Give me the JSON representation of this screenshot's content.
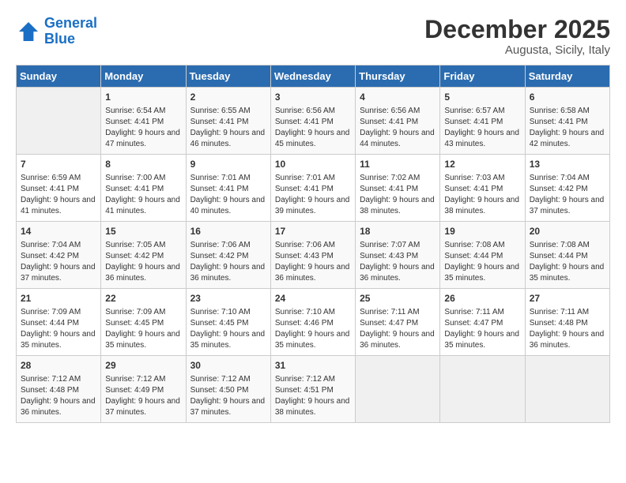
{
  "header": {
    "logo_line1": "General",
    "logo_line2": "Blue",
    "month_title": "December 2025",
    "location": "Augusta, Sicily, Italy"
  },
  "weekdays": [
    "Sunday",
    "Monday",
    "Tuesday",
    "Wednesday",
    "Thursday",
    "Friday",
    "Saturday"
  ],
  "weeks": [
    [
      {
        "day": "",
        "sunrise": "",
        "sunset": "",
        "daylight": ""
      },
      {
        "day": "1",
        "sunrise": "Sunrise: 6:54 AM",
        "sunset": "Sunset: 4:41 PM",
        "daylight": "Daylight: 9 hours and 47 minutes."
      },
      {
        "day": "2",
        "sunrise": "Sunrise: 6:55 AM",
        "sunset": "Sunset: 4:41 PM",
        "daylight": "Daylight: 9 hours and 46 minutes."
      },
      {
        "day": "3",
        "sunrise": "Sunrise: 6:56 AM",
        "sunset": "Sunset: 4:41 PM",
        "daylight": "Daylight: 9 hours and 45 minutes."
      },
      {
        "day": "4",
        "sunrise": "Sunrise: 6:56 AM",
        "sunset": "Sunset: 4:41 PM",
        "daylight": "Daylight: 9 hours and 44 minutes."
      },
      {
        "day": "5",
        "sunrise": "Sunrise: 6:57 AM",
        "sunset": "Sunset: 4:41 PM",
        "daylight": "Daylight: 9 hours and 43 minutes."
      },
      {
        "day": "6",
        "sunrise": "Sunrise: 6:58 AM",
        "sunset": "Sunset: 4:41 PM",
        "daylight": "Daylight: 9 hours and 42 minutes."
      }
    ],
    [
      {
        "day": "7",
        "sunrise": "Sunrise: 6:59 AM",
        "sunset": "Sunset: 4:41 PM",
        "daylight": "Daylight: 9 hours and 41 minutes."
      },
      {
        "day": "8",
        "sunrise": "Sunrise: 7:00 AM",
        "sunset": "Sunset: 4:41 PM",
        "daylight": "Daylight: 9 hours and 41 minutes."
      },
      {
        "day": "9",
        "sunrise": "Sunrise: 7:01 AM",
        "sunset": "Sunset: 4:41 PM",
        "daylight": "Daylight: 9 hours and 40 minutes."
      },
      {
        "day": "10",
        "sunrise": "Sunrise: 7:01 AM",
        "sunset": "Sunset: 4:41 PM",
        "daylight": "Daylight: 9 hours and 39 minutes."
      },
      {
        "day": "11",
        "sunrise": "Sunrise: 7:02 AM",
        "sunset": "Sunset: 4:41 PM",
        "daylight": "Daylight: 9 hours and 38 minutes."
      },
      {
        "day": "12",
        "sunrise": "Sunrise: 7:03 AM",
        "sunset": "Sunset: 4:41 PM",
        "daylight": "Daylight: 9 hours and 38 minutes."
      },
      {
        "day": "13",
        "sunrise": "Sunrise: 7:04 AM",
        "sunset": "Sunset: 4:42 PM",
        "daylight": "Daylight: 9 hours and 37 minutes."
      }
    ],
    [
      {
        "day": "14",
        "sunrise": "Sunrise: 7:04 AM",
        "sunset": "Sunset: 4:42 PM",
        "daylight": "Daylight: 9 hours and 37 minutes."
      },
      {
        "day": "15",
        "sunrise": "Sunrise: 7:05 AM",
        "sunset": "Sunset: 4:42 PM",
        "daylight": "Daylight: 9 hours and 36 minutes."
      },
      {
        "day": "16",
        "sunrise": "Sunrise: 7:06 AM",
        "sunset": "Sunset: 4:42 PM",
        "daylight": "Daylight: 9 hours and 36 minutes."
      },
      {
        "day": "17",
        "sunrise": "Sunrise: 7:06 AM",
        "sunset": "Sunset: 4:43 PM",
        "daylight": "Daylight: 9 hours and 36 minutes."
      },
      {
        "day": "18",
        "sunrise": "Sunrise: 7:07 AM",
        "sunset": "Sunset: 4:43 PM",
        "daylight": "Daylight: 9 hours and 36 minutes."
      },
      {
        "day": "19",
        "sunrise": "Sunrise: 7:08 AM",
        "sunset": "Sunset: 4:44 PM",
        "daylight": "Daylight: 9 hours and 35 minutes."
      },
      {
        "day": "20",
        "sunrise": "Sunrise: 7:08 AM",
        "sunset": "Sunset: 4:44 PM",
        "daylight": "Daylight: 9 hours and 35 minutes."
      }
    ],
    [
      {
        "day": "21",
        "sunrise": "Sunrise: 7:09 AM",
        "sunset": "Sunset: 4:44 PM",
        "daylight": "Daylight: 9 hours and 35 minutes."
      },
      {
        "day": "22",
        "sunrise": "Sunrise: 7:09 AM",
        "sunset": "Sunset: 4:45 PM",
        "daylight": "Daylight: 9 hours and 35 minutes."
      },
      {
        "day": "23",
        "sunrise": "Sunrise: 7:10 AM",
        "sunset": "Sunset: 4:45 PM",
        "daylight": "Daylight: 9 hours and 35 minutes."
      },
      {
        "day": "24",
        "sunrise": "Sunrise: 7:10 AM",
        "sunset": "Sunset: 4:46 PM",
        "daylight": "Daylight: 9 hours and 35 minutes."
      },
      {
        "day": "25",
        "sunrise": "Sunrise: 7:11 AM",
        "sunset": "Sunset: 4:47 PM",
        "daylight": "Daylight: 9 hours and 36 minutes."
      },
      {
        "day": "26",
        "sunrise": "Sunrise: 7:11 AM",
        "sunset": "Sunset: 4:47 PM",
        "daylight": "Daylight: 9 hours and 35 minutes."
      },
      {
        "day": "27",
        "sunrise": "Sunrise: 7:11 AM",
        "sunset": "Sunset: 4:48 PM",
        "daylight": "Daylight: 9 hours and 36 minutes."
      }
    ],
    [
      {
        "day": "28",
        "sunrise": "Sunrise: 7:12 AM",
        "sunset": "Sunset: 4:48 PM",
        "daylight": "Daylight: 9 hours and 36 minutes."
      },
      {
        "day": "29",
        "sunrise": "Sunrise: 7:12 AM",
        "sunset": "Sunset: 4:49 PM",
        "daylight": "Daylight: 9 hours and 37 minutes."
      },
      {
        "day": "30",
        "sunrise": "Sunrise: 7:12 AM",
        "sunset": "Sunset: 4:50 PM",
        "daylight": "Daylight: 9 hours and 37 minutes."
      },
      {
        "day": "31",
        "sunrise": "Sunrise: 7:12 AM",
        "sunset": "Sunset: 4:51 PM",
        "daylight": "Daylight: 9 hours and 38 minutes."
      },
      {
        "day": "",
        "sunrise": "",
        "sunset": "",
        "daylight": ""
      },
      {
        "day": "",
        "sunrise": "",
        "sunset": "",
        "daylight": ""
      },
      {
        "day": "",
        "sunrise": "",
        "sunset": "",
        "daylight": ""
      }
    ]
  ]
}
